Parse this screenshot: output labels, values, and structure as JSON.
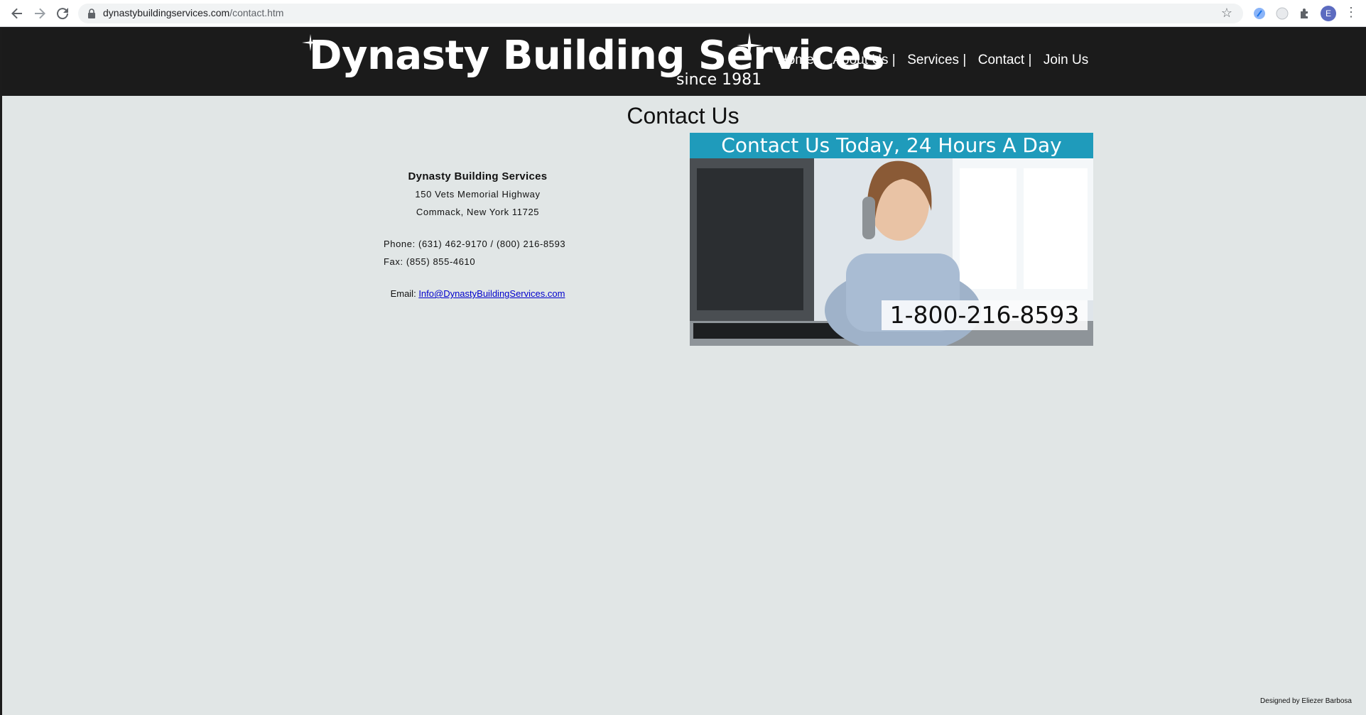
{
  "browser": {
    "url_domain": "dynastybuildingservices.com",
    "url_path": "/contact.htm",
    "avatar_letter": "E",
    "icons": [
      "back-arrow-icon",
      "forward-arrow-icon",
      "reload-icon",
      "lock-icon",
      "star-icon",
      "extension-icon",
      "puzzle-icon",
      "kebab-menu-icon"
    ]
  },
  "header": {
    "logo_title": "Dynasty Building Services",
    "logo_since": "since 1981",
    "nav": [
      {
        "label": "Home |"
      },
      {
        "label": "About Us |"
      },
      {
        "label": "Services |"
      },
      {
        "label": "Contact |"
      },
      {
        "label": "Join Us"
      }
    ]
  },
  "page": {
    "title": "Contact Us",
    "company": "Dynasty Building Services",
    "address_line1": "150 Vets Memorial Highway",
    "address_line2": "Commack, New York 11725",
    "phone": "Phone: (631) 462-9170 / (800) 216-8593",
    "fax": "Fax: (855) 855-4610",
    "email_label": "Email:",
    "email": "Info@DynastyBuildingServices.com"
  },
  "promo": {
    "banner": "Contact Us Today, 24 Hours A Day",
    "phone": "1-800-216-8593"
  },
  "footer": {
    "credit": "Designed by Eliezer Barbosa"
  },
  "colors": {
    "page_bg": "#e1e6e6",
    "header_bg": "#1b1b1b",
    "banner_teal": "#1f9bbb",
    "link": "#0000cc"
  }
}
